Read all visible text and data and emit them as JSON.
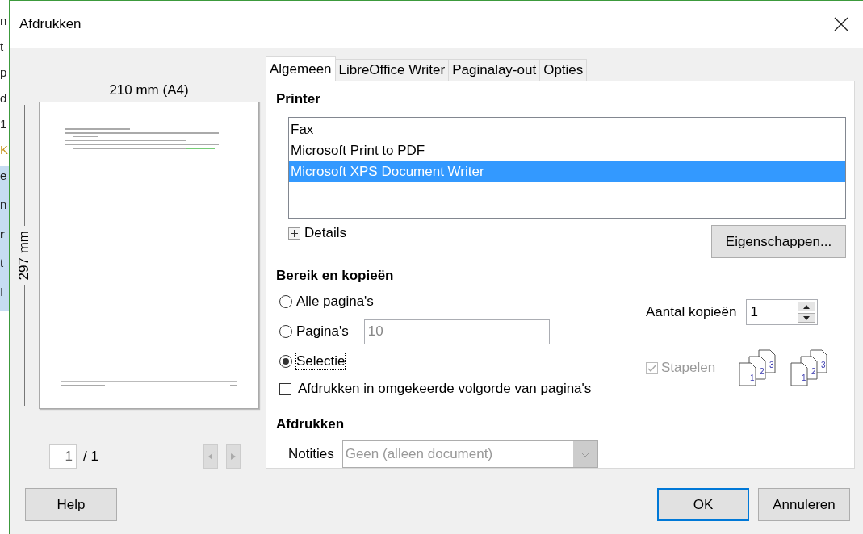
{
  "background_document": {
    "fragments": [
      {
        "text": "n",
        "kind": "plain"
      },
      {
        "text": "t",
        "kind": "plain"
      },
      {
        "text": "p",
        "kind": "plain"
      },
      {
        "text": "d",
        "kind": "plain"
      },
      {
        "text": "1",
        "kind": "plain"
      },
      {
        "text": "K",
        "kind": "accent"
      },
      {
        "text": "e",
        "kind": "highlighted"
      },
      {
        "text": "n",
        "kind": "highlighted"
      },
      {
        "text": "r",
        "kind": "highlighted_bold"
      },
      {
        "text": "t",
        "kind": "highlighted"
      },
      {
        "text": "I",
        "kind": "highlighted"
      }
    ]
  },
  "window": {
    "title": "Afdrukken"
  },
  "preview": {
    "width_label": "210 mm (A4)",
    "height_label": "297 mm",
    "page_input": "1",
    "page_total": "/ 1"
  },
  "tabs": [
    {
      "label": "Algemeen",
      "selected": true
    },
    {
      "label": "LibreOffice Writer",
      "selected": false
    },
    {
      "label": "Paginalay-out",
      "selected": false
    },
    {
      "label": "Opties",
      "selected": false
    }
  ],
  "printer": {
    "heading": "Printer",
    "printers": [
      {
        "name": "Fax",
        "selected": false
      },
      {
        "name": "Microsoft Print to PDF",
        "selected": false
      },
      {
        "name": "Microsoft XPS Document Writer",
        "selected": true
      }
    ],
    "details": {
      "label": "Details",
      "expanded": false
    },
    "properties_button": {
      "label": "Eigenschappen..."
    }
  },
  "range": {
    "heading": "Bereik en kopieën",
    "options": [
      {
        "label": "Alle pagina's",
        "selected": false,
        "focused": false
      },
      {
        "label": "Pagina's",
        "selected": false,
        "focused": false,
        "value": "10",
        "value_disabled": true
      },
      {
        "label": "Selectie",
        "selected": true,
        "focused": true
      }
    ],
    "reverse": {
      "label": "Afdrukken in omgekeerde volgorde van pagina's",
      "checked": false
    },
    "copies": {
      "label": "Aantal kopieën",
      "value": "1"
    },
    "collate": {
      "label": "Stapelen",
      "checked": true,
      "disabled": true,
      "icons": [
        {
          "page_numbers": [
            "1",
            "2",
            "3"
          ]
        },
        {
          "page_numbers": [
            "1",
            "2",
            "3"
          ]
        }
      ]
    }
  },
  "print": {
    "heading": "Afdrukken",
    "notes": {
      "label": "Notities",
      "value": "Geen (alleen document)",
      "disabled": true
    }
  },
  "buttons": [
    {
      "label": "Help",
      "default": false
    },
    {
      "label": "OK",
      "default": true
    },
    {
      "label": "Annuleren",
      "default": false
    }
  ]
}
